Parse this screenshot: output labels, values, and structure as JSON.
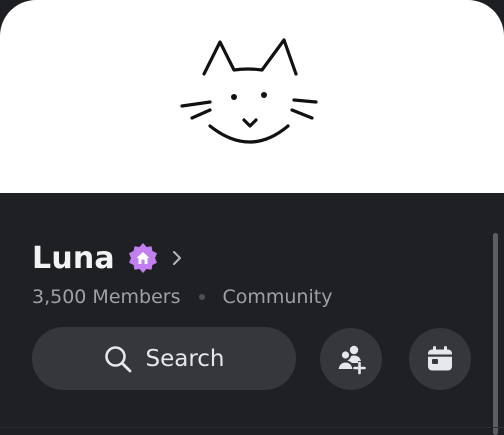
{
  "server": {
    "name": "Luna",
    "member_count": "3,500 Members",
    "category": "Community",
    "badge_icon": "community-house-badge-icon",
    "badge_color": "#c27ff0"
  },
  "actions": {
    "search_label": "Search",
    "invite_icon": "add-member-icon",
    "events_icon": "calendar-icon"
  },
  "banner": {
    "background": "#ffffff",
    "image": "cat-face-doodle"
  }
}
